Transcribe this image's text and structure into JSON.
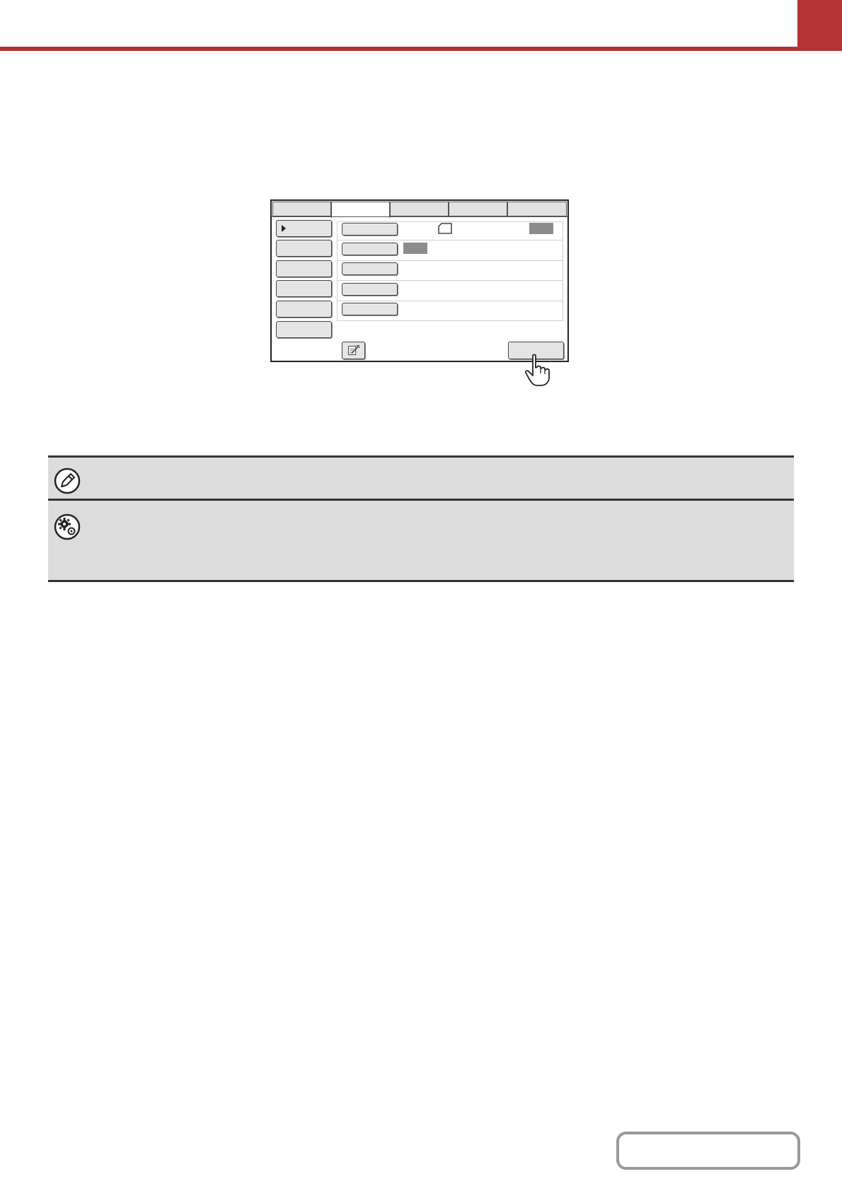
{
  "header": {
    "accent_color": "#b33236"
  },
  "illustration": {
    "tabs": [
      "",
      "",
      "",
      "",
      ""
    ],
    "active_tab_index": 1,
    "side_buttons": [
      "",
      "",
      "",
      "",
      "",
      ""
    ],
    "row_buttons": [
      "",
      "",
      "",
      "",
      ""
    ],
    "edit_icon": "edit-icon",
    "ok_button_label": "",
    "pointer_icon": "hand-pointer-icon"
  },
  "notes": {
    "note_icon": "pencil-note-icon",
    "note_text": "",
    "settings_icon": "gear-settings-icon",
    "settings_text": ""
  },
  "footer": {
    "contents_label": ""
  }
}
